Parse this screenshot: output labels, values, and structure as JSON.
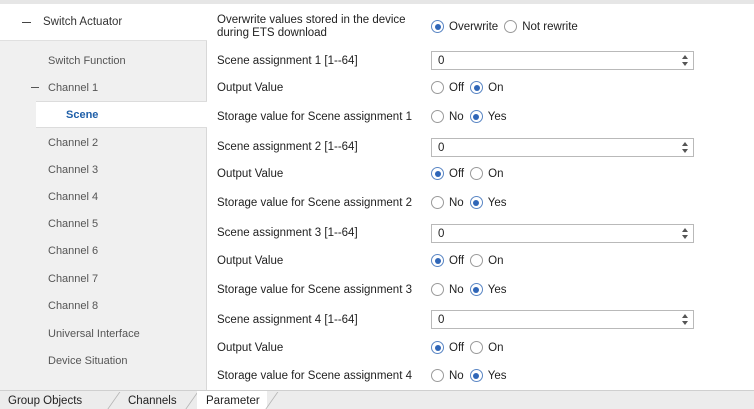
{
  "sidebar": {
    "root_label": "Switch Actuator",
    "items": [
      {
        "label": "Switch Function"
      },
      {
        "label": "Channel 1"
      },
      {
        "label": "Scene"
      },
      {
        "label": "Channel 2"
      },
      {
        "label": "Channel 3"
      },
      {
        "label": "Channel 4"
      },
      {
        "label": "Channel 5"
      },
      {
        "label": "Channel 6"
      },
      {
        "label": "Channel 7"
      },
      {
        "label": "Channel 8"
      },
      {
        "label": "Universal Interface"
      },
      {
        "label": "Device Situation"
      }
    ]
  },
  "params": {
    "overwrite": {
      "label": "Overwrite values stored in the device during ETS download",
      "opt1": "Overwrite",
      "opt2": "Not rewrite",
      "selected": "Overwrite"
    },
    "scenes": [
      {
        "assign_label": "Scene assignment 1 [1--64]",
        "assign_value": "0",
        "output_label": "Output Value",
        "output_off": "Off",
        "output_on": "On",
        "output_selected": "On",
        "storage_label": "Storage value for Scene assignment 1",
        "storage_no": "No",
        "storage_yes": "Yes",
        "storage_selected": "Yes"
      },
      {
        "assign_label": "Scene assignment 2 [1--64]",
        "assign_value": "0",
        "output_label": "Output Value",
        "output_off": "Off",
        "output_on": "On",
        "output_selected": "Off",
        "storage_label": "Storage value for Scene assignment 2",
        "storage_no": "No",
        "storage_yes": "Yes",
        "storage_selected": "Yes"
      },
      {
        "assign_label": "Scene assignment 3 [1--64]",
        "assign_value": "0",
        "output_label": "Output Value",
        "output_off": "Off",
        "output_on": "On",
        "output_selected": "Off",
        "storage_label": "Storage value for Scene assignment 3",
        "storage_no": "No",
        "storage_yes": "Yes",
        "storage_selected": "Yes"
      },
      {
        "assign_label": "Scene assignment 4 [1--64]",
        "assign_value": "0",
        "output_label": "Output Value",
        "output_off": "Off",
        "output_on": "On",
        "output_selected": "Off",
        "storage_label": "Storage value for Scene assignment 4",
        "storage_no": "No",
        "storage_yes": "Yes",
        "storage_selected": "Yes"
      }
    ]
  },
  "tabs": [
    {
      "label": "Group Objects"
    },
    {
      "label": "Channels"
    },
    {
      "label": "Parameter"
    }
  ],
  "active_tab": "Parameter",
  "colors": {
    "selected_tree_text": "#1f5fa8",
    "radio_selected": "#2f66b8"
  }
}
